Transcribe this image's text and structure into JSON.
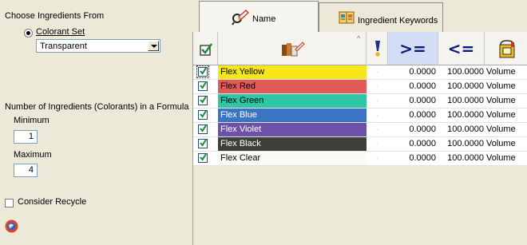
{
  "left": {
    "choose_label": "Choose Ingredients From",
    "colorant_set_label": "Colorant Set",
    "colorant_set_value": "Transparent",
    "number_label": "Number of Ingredients (Colorants) in a Formula",
    "minimum_label": "Minimum",
    "minimum_value": "1",
    "maximum_label": "Maximum",
    "maximum_value": "4",
    "recycle_label": "Consider Recycle"
  },
  "tabs": [
    {
      "label": "Name",
      "icon": "magnifier-pencil-icon",
      "active": true
    },
    {
      "label": "Ingredient Keywords",
      "icon": "book-icon",
      "active": false
    }
  ],
  "grid": {
    "headers": {
      "check_icon": "check-icon",
      "name_icon": "paint-tubes-pencil-icon",
      "exclaim_icon": "exclamation-icon",
      "ge": ">=",
      "le": "<=",
      "unit_icon": "paint-can-icon"
    },
    "rows": [
      {
        "checked": true,
        "name": "Flex Yellow",
        "color": "#f7e61c",
        "text_color": "#000000",
        "dash": "-",
        "min": "0.0000",
        "max": "100.0000",
        "unit": "Volume"
      },
      {
        "checked": true,
        "name": "Flex Red",
        "color": "#e35a5a",
        "text_color": "#000000",
        "dash": "-",
        "min": "0.0000",
        "max": "100.0000",
        "unit": "Volume"
      },
      {
        "checked": true,
        "name": "Flex Green",
        "color": "#2ec6a5",
        "text_color": "#000000",
        "dash": "-",
        "min": "0.0000",
        "max": "100.0000",
        "unit": "Volume"
      },
      {
        "checked": true,
        "name": "Flex Blue",
        "color": "#3b74c4",
        "text_color": "#ffffff",
        "dash": "-",
        "min": "0.0000",
        "max": "100.0000",
        "unit": "Volume"
      },
      {
        "checked": true,
        "name": "Flex Violet",
        "color": "#6c52a6",
        "text_color": "#ffffff",
        "dash": "-",
        "min": "0.0000",
        "max": "100.0000",
        "unit": "Volume"
      },
      {
        "checked": true,
        "name": "Flex Black",
        "color": "#3e3e3a",
        "text_color": "#ffffff",
        "dash": "-",
        "min": "0.0000",
        "max": "100.0000",
        "unit": "Volume"
      },
      {
        "checked": true,
        "name": "Flex Clear",
        "color": "#fbfbf5",
        "text_color": "#000000",
        "dash": "-",
        "min": "0.0000",
        "max": "100.0000",
        "unit": "Volume"
      }
    ]
  }
}
